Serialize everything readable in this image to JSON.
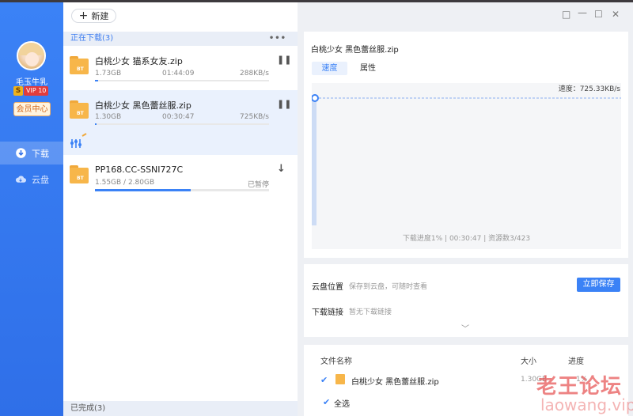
{
  "user": {
    "name": "毛玉牛乳",
    "vip_mark": "S",
    "vip_level": "VIP 10",
    "member_btn": "会员中心"
  },
  "nav": [
    {
      "label": "下载",
      "icon": "download-icon",
      "active": true
    },
    {
      "label": "云盘",
      "icon": "cloud-icon",
      "active": false
    }
  ],
  "toolbar": {
    "new_label": "新建"
  },
  "downloading": {
    "header": "正在下载(3)",
    "tasks": [
      {
        "name": "白桃少女 猫系女友.zip",
        "size": "1.73GB",
        "time": "01:44:09",
        "speed": "288KB/s",
        "progress": 0.02,
        "action": "pause"
      },
      {
        "name": "白桃少女 黑色蕾丝服.zip",
        "size": "1.30GB",
        "time": "00:30:47",
        "speed": "725KB/s",
        "progress": 0.01,
        "action": "pause"
      },
      {
        "name": "PP168.CC-SSNI727C",
        "size": "1.55GB / 2.80GB",
        "time": "",
        "speed": "已暂停",
        "progress": 0.55,
        "action": "resume"
      }
    ]
  },
  "completed": {
    "header": "已完成(3)"
  },
  "detail": {
    "file_title": "白桃少女 黑色蕾丝服.zip",
    "tabs": [
      "速度",
      "属性"
    ],
    "speed_label": "速度：725.33KB/s",
    "footer": "下载进度1%  |  00:30:47  |  资源数3/423"
  },
  "cloud": {
    "label": "云盘位置",
    "hint": "保存到云盘，可随时查看",
    "save_btn": "立即保存",
    "link_label": "下载链接",
    "link_hint": "暂无下载链接"
  },
  "files": {
    "col_name": "文件名称",
    "col_size": "大小",
    "col_progress": "进度",
    "rows": [
      {
        "name": "白桃少女 黑色蕾丝服.zip",
        "size": "1.30GB",
        "progress": "1%"
      }
    ],
    "select_all": "全选"
  },
  "watermark": {
    "line1": "老王论坛",
    "line2": "laowang.vip"
  },
  "colors": {
    "accent": "#3b82f6",
    "sidebar": "#2f6fe8",
    "folder": "#f7b64a"
  }
}
